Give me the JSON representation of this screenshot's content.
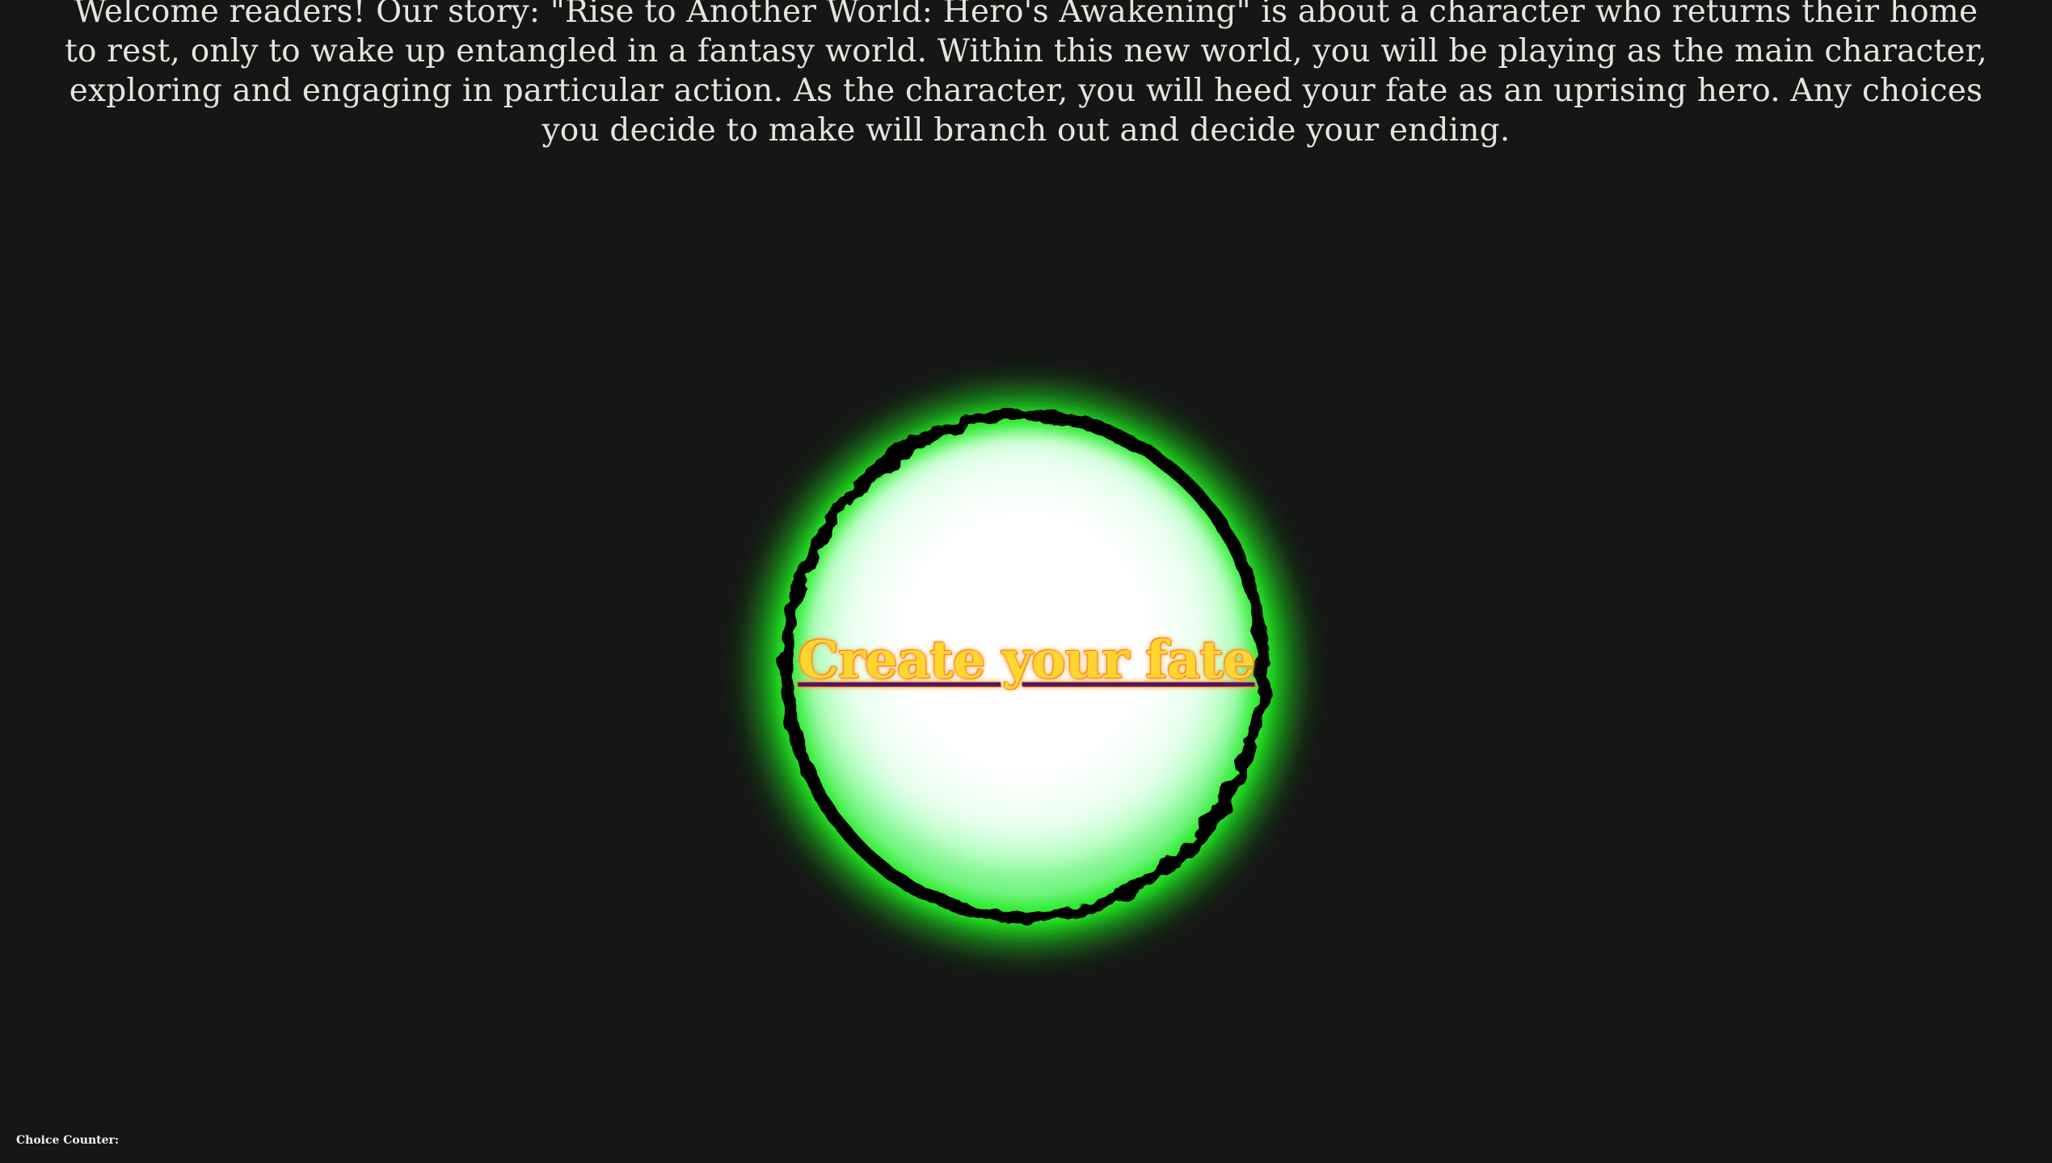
{
  "intro": {
    "text": "Welcome readers! Our story: \"Rise to Another World: Hero's Awakening\" is about a character who returns their home to rest, only to wake up entangled in a fantasy world. Within this new world, you will be playing as the main character, exploring and engaging in particular action. As the character, you will heed your fate as an uprising hero. Any choices you decide to make will branch out and decide your ending."
  },
  "portal": {
    "button_label": "Create your fate",
    "glow_color": "#22e022",
    "core_color": "#ffffff",
    "ring_color": "#050505",
    "label_color": "#ffd530"
  },
  "footer": {
    "counter_label": "Choice Counter:"
  }
}
